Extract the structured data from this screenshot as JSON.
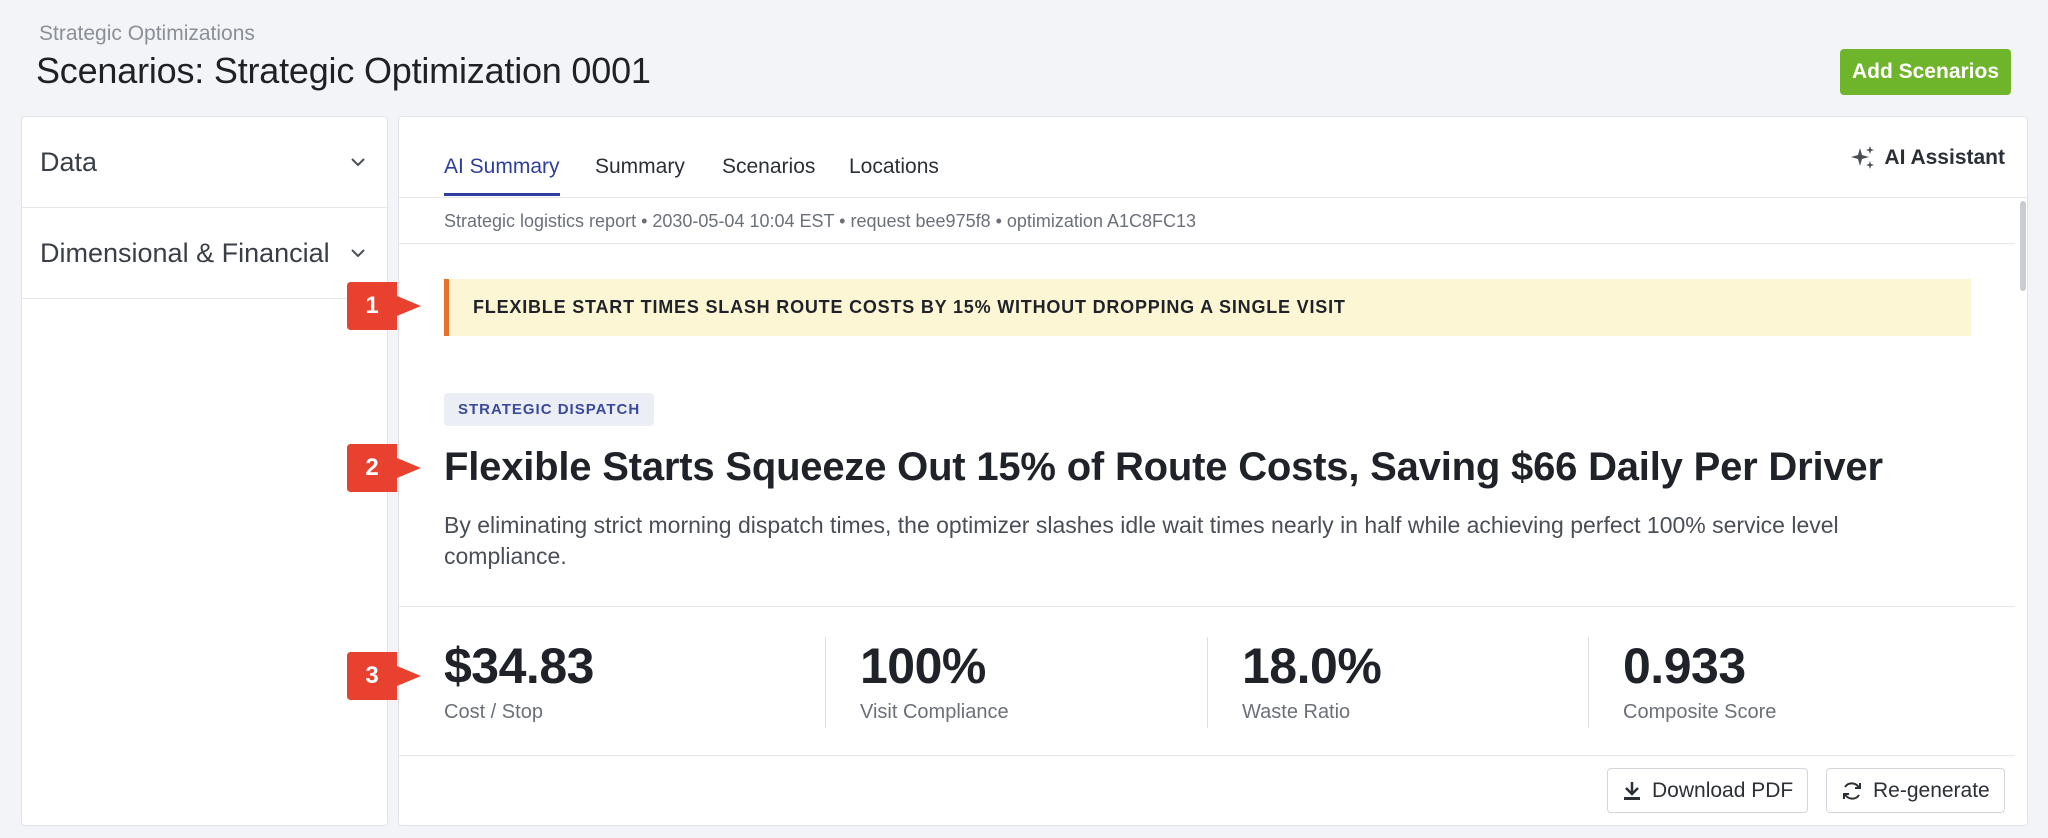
{
  "header": {
    "breadcrumb": "Strategic Optimizations",
    "title": "Scenarios: Strategic Optimization 0001",
    "add_button": "Add Scenarios"
  },
  "sidebar": {
    "items": [
      {
        "label": "Data"
      },
      {
        "label": "Dimensional & Financial"
      }
    ]
  },
  "tabs": [
    {
      "label": "AI Summary",
      "active": true
    },
    {
      "label": "Summary"
    },
    {
      "label": "Scenarios"
    },
    {
      "label": "Locations"
    }
  ],
  "ai_assistant": "AI Assistant",
  "report": {
    "meta": "Strategic logistics report • 2030-05-04 10:04 EST • request bee975f8 • optimization A1C8FC13",
    "banner": "FLEXIBLE START TIMES SLASH ROUTE COSTS BY 15% WITHOUT DROPPING A SINGLE VISIT",
    "tag": "STRATEGIC DISPATCH",
    "headline": "Flexible Starts Squeeze Out 15% of Route Costs, Saving $66 Daily Per Driver",
    "subhead": "By eliminating strict morning dispatch times, the optimizer slashes idle wait times nearly in half while achieving perfect 100% service level compliance."
  },
  "kpis": [
    {
      "value": "$34.83",
      "label": "Cost / Stop"
    },
    {
      "value": "100%",
      "label": "Visit Compliance"
    },
    {
      "value": "18.0%",
      "label": "Waste Ratio"
    },
    {
      "value": "0.933",
      "label": "Composite Score"
    }
  ],
  "footer": {
    "download": "Download PDF",
    "regenerate": "Re-generate"
  },
  "markers": [
    "1",
    "2",
    "3"
  ],
  "colors": {
    "accent": "#2f3e9e",
    "add_button": "#6fb52c",
    "banner_bg": "#fdf6d4",
    "banner_border": "#e8722b",
    "marker": "#e8412f"
  }
}
